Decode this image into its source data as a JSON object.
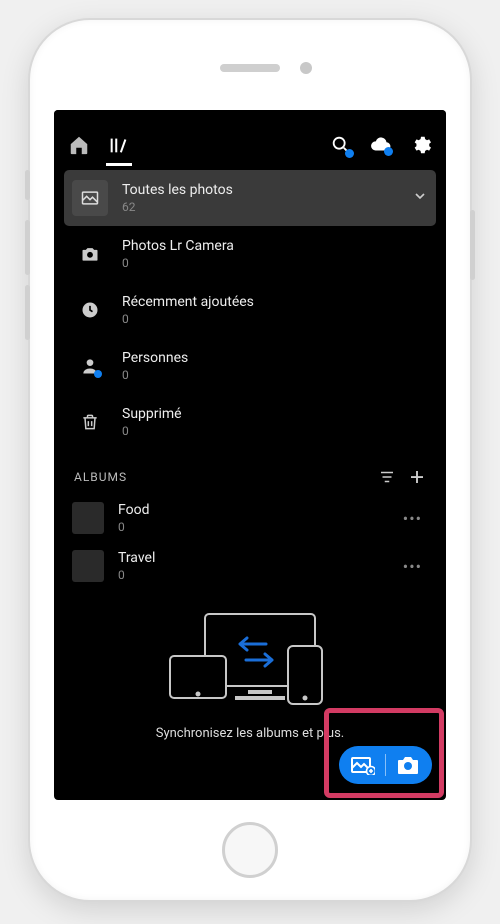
{
  "topbar": {
    "home": "home",
    "library": "library",
    "search": "search",
    "cloud": "cloud",
    "settings": "settings"
  },
  "collections": [
    {
      "key": "all",
      "title": "Toutes les photos",
      "count": "62",
      "icon": "image",
      "selected": true,
      "expandable": true
    },
    {
      "key": "lrcam",
      "title": "Photos Lr Camera",
      "count": "0",
      "icon": "camera"
    },
    {
      "key": "recent",
      "title": "Récemment ajoutées",
      "count": "0",
      "icon": "clock"
    },
    {
      "key": "people",
      "title": "Personnes",
      "count": "0",
      "icon": "person"
    },
    {
      "key": "deleted",
      "title": "Supprimé",
      "count": "0",
      "icon": "trash"
    }
  ],
  "albums_section": {
    "label": "ALBUMS",
    "sort": "sort",
    "add": "add"
  },
  "albums": [
    {
      "title": "Food",
      "count": "0"
    },
    {
      "title": "Travel",
      "count": "0"
    }
  ],
  "sync_message": "Synchronisez les albums et plus.",
  "fab": {
    "add_photo": "add-photo",
    "camera": "camera"
  }
}
